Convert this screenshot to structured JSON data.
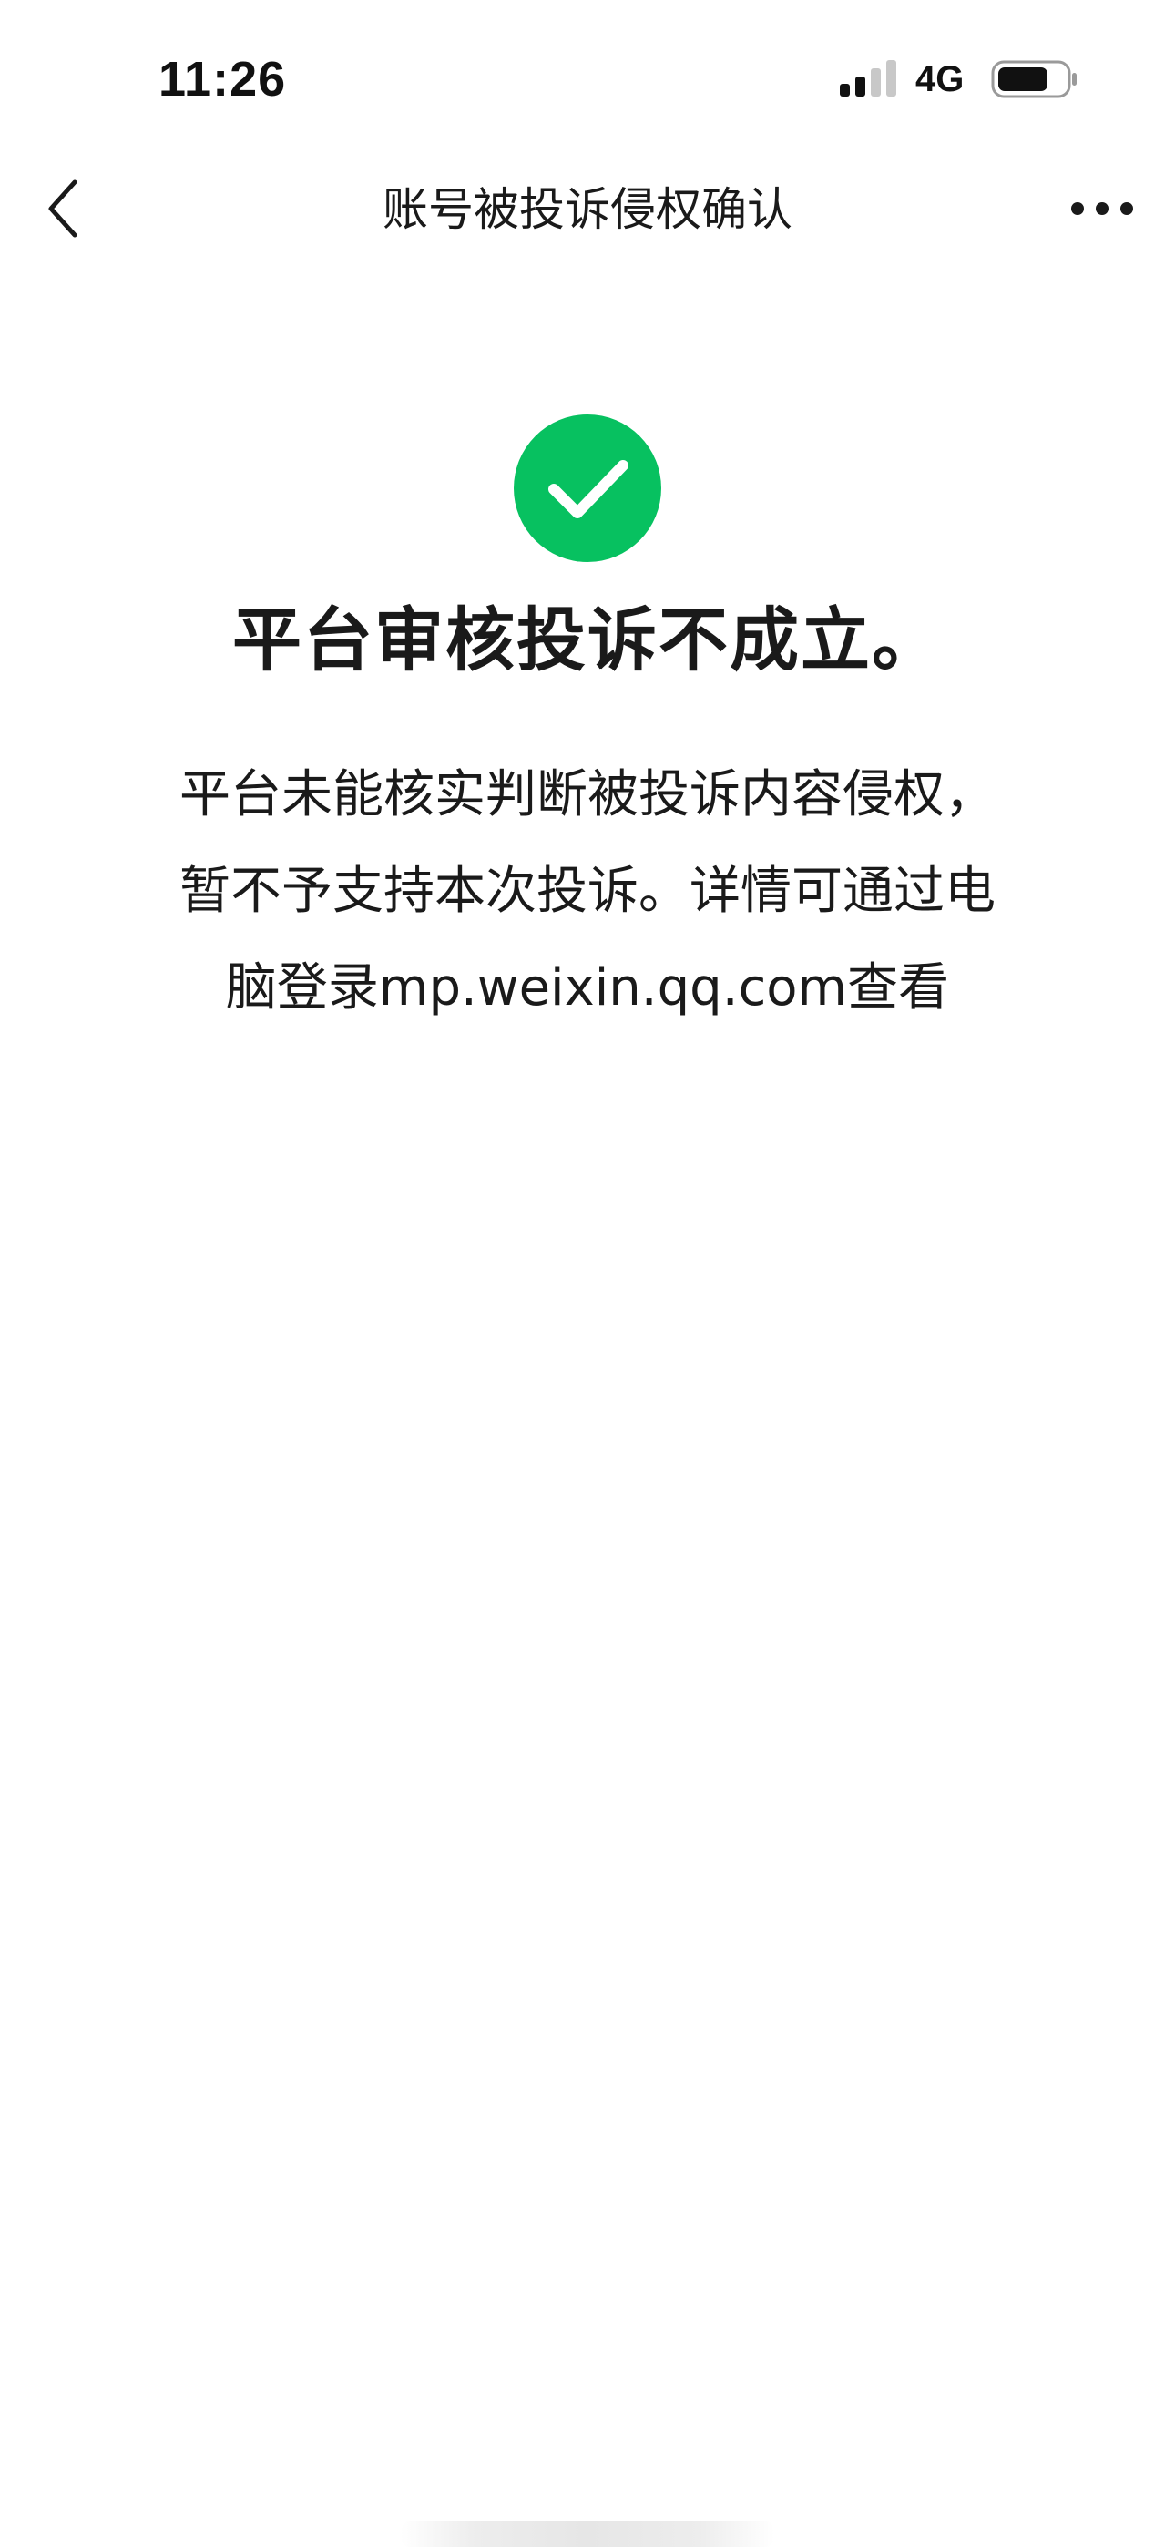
{
  "status_bar": {
    "time": "11:26",
    "network": "4G",
    "icons": [
      "signal-icon",
      "battery-icon"
    ]
  },
  "nav": {
    "title": "账号被投诉侵权确认",
    "back_icon": "chevron-left-icon",
    "more_icon": "more-dots-icon"
  },
  "result": {
    "icon": "check-circle-icon",
    "icon_color": "#07C160",
    "title": "平台审核投诉不成立。",
    "description_lines": [
      "平台未能核实判断被投诉内容侵权，",
      "暂不予支持本次投诉。详情可通过电",
      "脑登录mp.weixin.qq.com查看"
    ]
  }
}
